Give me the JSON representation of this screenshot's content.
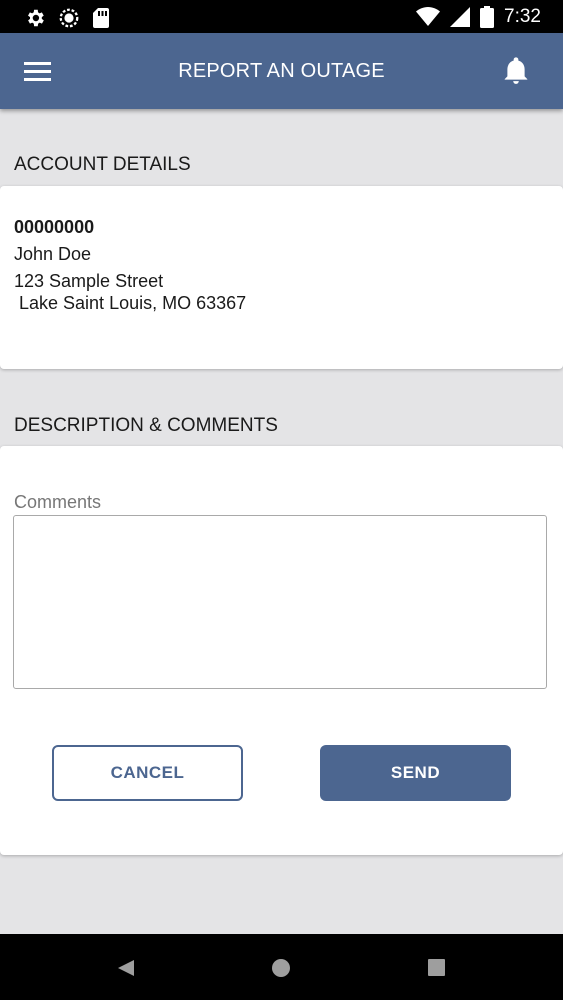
{
  "status_bar": {
    "time": "7:32",
    "icons": [
      "gear-icon",
      "sync-icon",
      "sd-card-icon",
      "wifi-icon",
      "signal-icon",
      "battery-icon"
    ]
  },
  "app_bar": {
    "title": "REPORT AN OUTAGE",
    "menu_icon": "hamburger-menu-icon",
    "notification_icon": "bell-icon",
    "color": "#4c6690"
  },
  "account_details": {
    "section_title": "ACCOUNT DETAILS",
    "account_number": "00000000",
    "name": "John Doe",
    "street": "123 Sample Street",
    "city_line": " Lake Saint Louis, MO 63367"
  },
  "description": {
    "section_title": "DESCRIPTION & COMMENTS",
    "comments_label": "Comments",
    "comments_value": ""
  },
  "actions": {
    "cancel_label": "CANCEL",
    "send_label": "SEND"
  },
  "nav_bar": {
    "icons": [
      "back-icon",
      "home-icon",
      "recents-icon"
    ]
  }
}
